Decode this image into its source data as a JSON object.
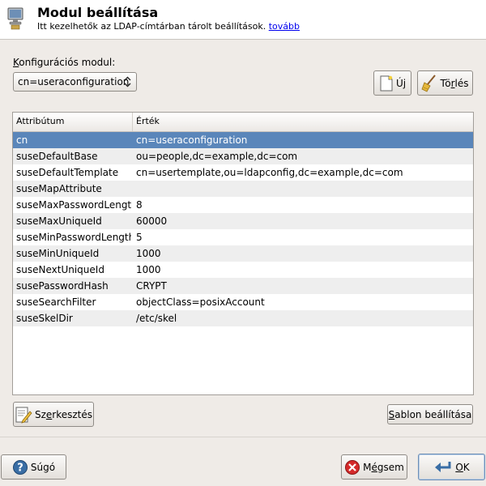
{
  "header": {
    "title": "Modul beállítása",
    "subtitle": "Itt kezelhetők az LDAP-címtárban tárolt beállítások.",
    "more_link": "tovább"
  },
  "config": {
    "label_underlined": "K",
    "label_rest": "onfigurációs modul:",
    "selected_module": "cn=useraconfiguration"
  },
  "buttons": {
    "new_label": "Új",
    "delete_label_pre": "Tö",
    "delete_label_underlined": "r",
    "delete_label_post": "lés",
    "edit_label_pre": "Sz",
    "edit_label_underlined": "e",
    "edit_label_post": "rkesztés",
    "template_label_underlined": "S",
    "template_label_rest": "ablon beállítása",
    "help_label": "Súgó",
    "cancel_label_pre": "M",
    "cancel_label_underlined": "é",
    "cancel_label_post": "gsem",
    "ok_label_underlined": "O",
    "ok_label_rest": "K"
  },
  "table": {
    "columns": [
      "Attribútum",
      "Érték"
    ],
    "selected_index": 0,
    "rows": [
      {
        "attribute": "cn",
        "value": "cn=useraconfiguration"
      },
      {
        "attribute": "suseDefaultBase",
        "value": "ou=people,dc=example,dc=com"
      },
      {
        "attribute": "suseDefaultTemplate",
        "value": "cn=usertemplate,ou=ldapconfig,dc=example,dc=com"
      },
      {
        "attribute": "suseMapAttribute",
        "value": ""
      },
      {
        "attribute": "suseMaxPasswordLength",
        "value": "8"
      },
      {
        "attribute": "suseMaxUniqueId",
        "value": "60000"
      },
      {
        "attribute": "suseMinPasswordLength",
        "value": "5"
      },
      {
        "attribute": "suseMinUniqueId",
        "value": "1000"
      },
      {
        "attribute": "suseNextUniqueId",
        "value": "1000"
      },
      {
        "attribute": "susePasswordHash",
        "value": "CRYPT"
      },
      {
        "attribute": "suseSearchFilter",
        "value": "objectClass=posixAccount"
      },
      {
        "attribute": "suseSkelDir",
        "value": "/etc/skel"
      }
    ]
  },
  "colors": {
    "selection": "#5a86ba",
    "link": "#0000ee",
    "window_bg": "#efebe7"
  }
}
